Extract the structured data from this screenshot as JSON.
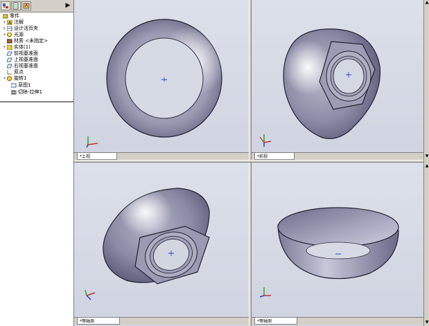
{
  "tree": {
    "root_label": "零件",
    "items": [
      {
        "label": "注解",
        "icon": "annotations-icon"
      },
      {
        "label": "设计活页夹",
        "icon": "design-binder-icon"
      },
      {
        "label": "光源",
        "icon": "lights-icon"
      },
      {
        "label": "材质 <未指定>",
        "icon": "material-icon"
      },
      {
        "label": "实体(1)",
        "icon": "solid-bodies-icon"
      },
      {
        "label": "前视基准面",
        "icon": "plane-icon"
      },
      {
        "label": "上视基准面",
        "icon": "plane-icon"
      },
      {
        "label": "右视基准面",
        "icon": "plane-icon"
      },
      {
        "label": "原点",
        "icon": "origin-icon"
      },
      {
        "label": "旋转1",
        "icon": "revolve-icon"
      },
      {
        "label": "草图1",
        "icon": "sketch-icon"
      },
      {
        "label": "切除-拉伸1",
        "icon": "cut-extrude-icon"
      }
    ]
  },
  "viewports": {
    "top_left_tab": "*上视",
    "top_right_tab": "*前视",
    "bottom_left_tab": "*等轴测",
    "bottom_right_tab": "*等轴测"
  },
  "colors": {
    "viewport_bg": "#d3d7e2",
    "model": "#8f8fa8",
    "edge": "#202030"
  }
}
